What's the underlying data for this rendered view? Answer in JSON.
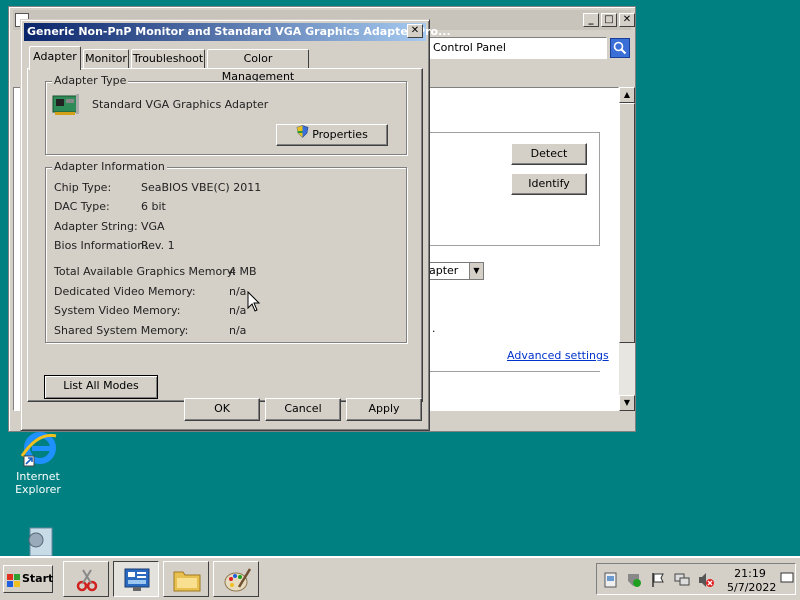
{
  "background_window": {
    "address_text": "Control Panel",
    "buttons": {
      "detect": "Detect",
      "identify": "Identify",
      "minimize": "_",
      "maximize": "□",
      "close": "✕"
    },
    "dropdown_value": "apter",
    "advanced_link": "Advanced settings",
    "period_fragment": "."
  },
  "dialog": {
    "title": "Generic Non-PnP Monitor and Standard VGA Graphics Adapter Pro...",
    "close_glyph": "✕",
    "tabs": [
      "Adapter",
      "Monitor",
      "Troubleshoot",
      "Color Management"
    ],
    "active_tab": "Adapter",
    "adapter_type": {
      "heading": "Adapter Type",
      "name": "Standard VGA Graphics Adapter",
      "properties_button": "Properties"
    },
    "adapter_info": {
      "heading": "Adapter Information",
      "rows": [
        {
          "label": "Chip Type:",
          "value": "SeaBIOS VBE(C) 2011"
        },
        {
          "label": "DAC Type:",
          "value": "6 bit"
        },
        {
          "label": "Adapter String:",
          "value": "VGA"
        },
        {
          "label": "Bios Information:",
          "value": "Rev. 1"
        }
      ],
      "memory_rows": [
        {
          "label": "Total Available Graphics Memory:",
          "value": "4 MB"
        },
        {
          "label": "Dedicated Video Memory:",
          "value": "n/a"
        },
        {
          "label": "System Video Memory:",
          "value": "n/a"
        },
        {
          "label": "Shared System Memory:",
          "value": "n/a"
        }
      ]
    },
    "list_all_modes_button": "List All Modes",
    "ok_button": "OK",
    "cancel_button": "Cancel",
    "apply_button": "Apply"
  },
  "desktop": {
    "icons": [
      {
        "label_line1": "Internet",
        "label_line2": "Explorer",
        "icon": "internet-explorer-icon"
      },
      {
        "label_line1": "",
        "label_line2": "",
        "icon": "control-panel-icon"
      }
    ]
  },
  "taskbar": {
    "start_label": "Start",
    "tasks": [
      {
        "icon": "snipping-tool-icon",
        "pressed": false
      },
      {
        "icon": "display-settings-icon",
        "pressed": true
      },
      {
        "icon": "folder-icon",
        "pressed": false
      },
      {
        "icon": "paint-icon",
        "pressed": false
      }
    ],
    "tray_icons": [
      "network-icon",
      "security-icon",
      "action-center-flag-icon",
      "display-icon",
      "volume-muted-icon"
    ],
    "clock_time": "21:19",
    "clock_date": "5/7/2022"
  },
  "colors": {
    "desktop": "#008080",
    "dialog_face": "#d4d0c8",
    "title_start": "#0a246a",
    "title_end": "#a6caf0",
    "link": "#0033cc"
  }
}
